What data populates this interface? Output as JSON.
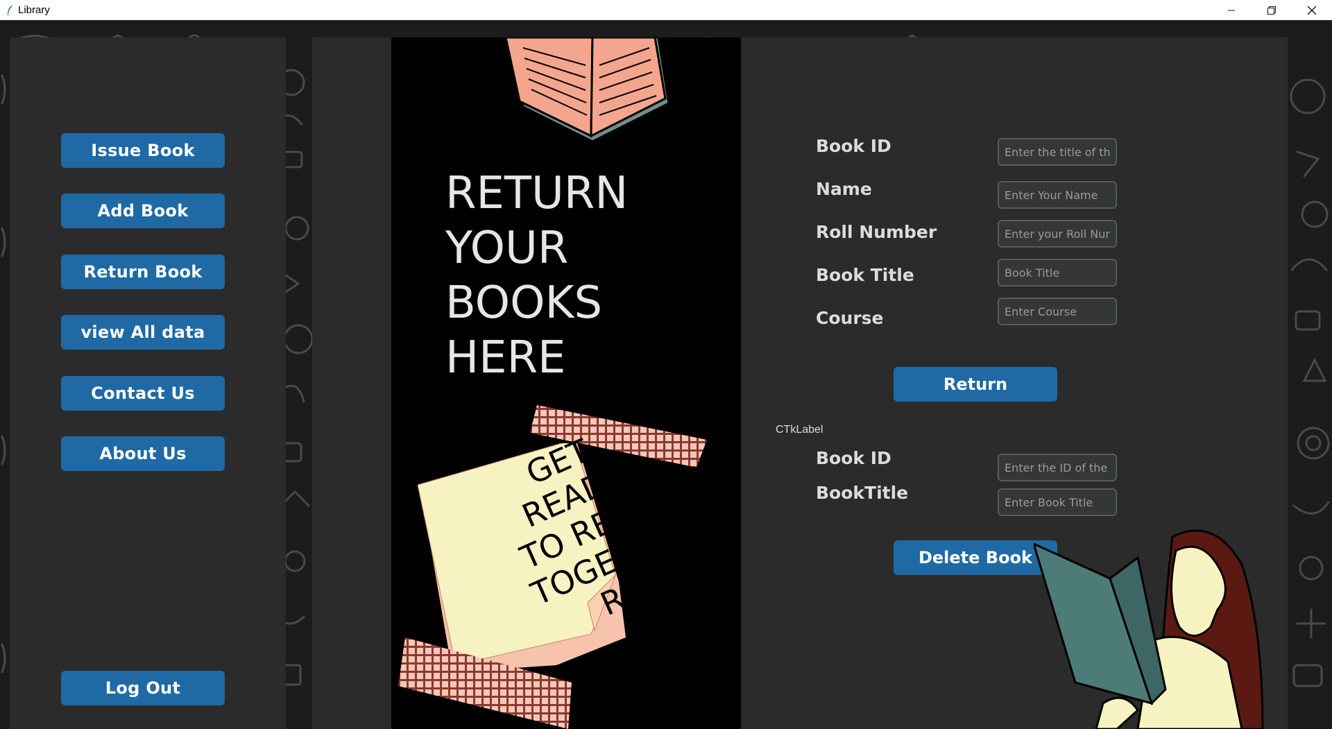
{
  "window": {
    "title": "Library",
    "controls": {
      "minimize": "minimize-icon",
      "maximize": "restore-icon",
      "close": "close-icon"
    }
  },
  "sidebar": {
    "buttons": [
      "Issue Book",
      "Add Book",
      "Return Book",
      "view All data",
      "Contact Us",
      "About Us"
    ],
    "logout": "Log Out"
  },
  "poster": {
    "headline": [
      "RETURN",
      "YOUR",
      "BOOKS",
      "HERE"
    ],
    "note": [
      "GET",
      "READY",
      "TO READ",
      "TOGETHE",
      "R!"
    ]
  },
  "return_form": {
    "fields": [
      {
        "label": "Book ID",
        "placeholder": "Enter the title of the bo"
      },
      {
        "label": "Name",
        "placeholder": "Enter Your Name"
      },
      {
        "label": "Roll Number",
        "placeholder": "Enter your Roll Numbe"
      },
      {
        "label": "Book Title",
        "placeholder": "Book Title"
      },
      {
        "label": "Course",
        "placeholder": "Enter Course"
      }
    ],
    "submit": "Return"
  },
  "delete_form": {
    "caption": "CTkLabel",
    "fields": [
      {
        "label": "Book ID",
        "placeholder": "Enter the ID of the boo"
      },
      {
        "label": "BookTitle",
        "placeholder": "Enter Book Title"
      }
    ],
    "submit": "Delete Book"
  },
  "colors": {
    "accent": "#1f6aa5",
    "panel": "#2b2b2b",
    "poster_bg": "#000000",
    "book": "#f4a58e",
    "note": "#f7f2c2",
    "tape": "#8a3a2e"
  }
}
